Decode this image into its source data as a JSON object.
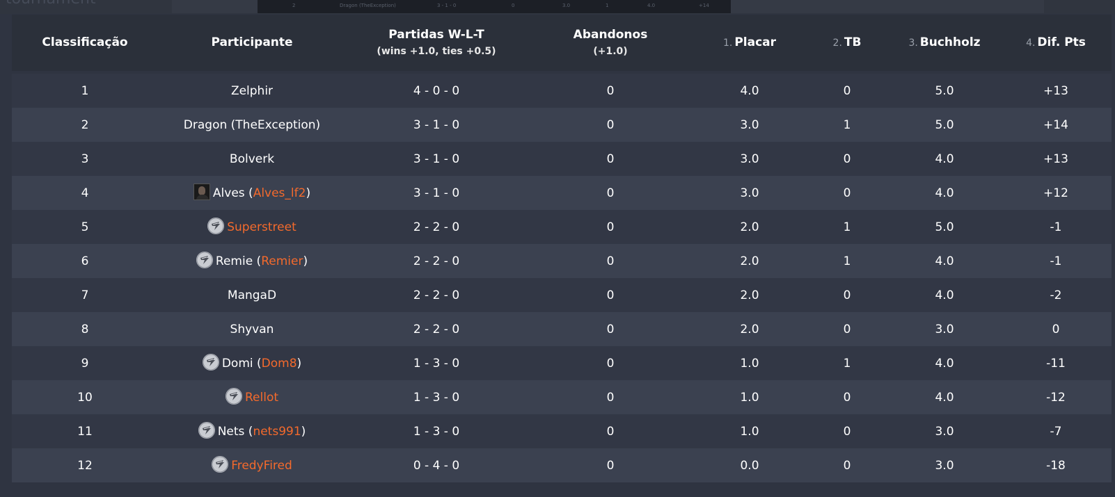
{
  "background_title": "-tournament",
  "background_row": {
    "rank": "2",
    "name": "Dragon (TheException)",
    "record": "3 - 1 - 0",
    "forfeits": "0",
    "score": "3.0",
    "tb": "1",
    "buchholz": "4.0",
    "diff": "+14"
  },
  "colors": {
    "accent": "#f46a2c",
    "header_bg": "#2b303a",
    "row_odd": "#3b4150",
    "row_even": "#323745"
  },
  "columns": {
    "rank": "Classificação",
    "participant": "Participante",
    "record": "Partidas W-L-T",
    "record_sub": "(wins +1.0, ties +0.5)",
    "forfeits": "Abandonos",
    "forfeits_sub": "(+1.0)",
    "score_prio": "1.",
    "score": "Placar",
    "tb_prio": "2.",
    "tb": "TB",
    "buchholz_prio": "3.",
    "buchholz": "Buchholz",
    "diff_prio": "4.",
    "diff": "Dif. Pts"
  },
  "rows": [
    {
      "rank": "1",
      "name": "Zelphir",
      "user": "",
      "avatar": "none",
      "record": "4 - 0 - 0",
      "forfeits": "0",
      "score": "4.0",
      "tb": "0",
      "buchholz": "5.0",
      "diff": "+13"
    },
    {
      "rank": "2",
      "name": "Dragon (TheException)",
      "user": "",
      "avatar": "none",
      "record": "3 - 1 - 0",
      "forfeits": "0",
      "score": "3.0",
      "tb": "1",
      "buchholz": "5.0",
      "diff": "+14"
    },
    {
      "rank": "3",
      "name": "Bolverk",
      "user": "",
      "avatar": "none",
      "record": "3 - 1 - 0",
      "forfeits": "0",
      "score": "3.0",
      "tb": "0",
      "buchholz": "4.0",
      "diff": "+13"
    },
    {
      "rank": "4",
      "name": "Alves",
      "user": "Alves_lf2",
      "avatar": "photo-avatar-icon",
      "record": "3 - 1 - 0",
      "forfeits": "0",
      "score": "3.0",
      "tb": "0",
      "buchholz": "4.0",
      "diff": "+12"
    },
    {
      "rank": "5",
      "name": "",
      "user": "Superstreet",
      "avatar": "logo-avatar-icon",
      "record": "2 - 2 - 0",
      "forfeits": "0",
      "score": "2.0",
      "tb": "1",
      "buchholz": "5.0",
      "diff": "-1"
    },
    {
      "rank": "6",
      "name": "Remie",
      "user": "Remier",
      "avatar": "logo-avatar-icon",
      "record": "2 - 2 - 0",
      "forfeits": "0",
      "score": "2.0",
      "tb": "1",
      "buchholz": "4.0",
      "diff": "-1"
    },
    {
      "rank": "7",
      "name": "MangaD",
      "user": "",
      "avatar": "none",
      "record": "2 - 2 - 0",
      "forfeits": "0",
      "score": "2.0",
      "tb": "0",
      "buchholz": "4.0",
      "diff": "-2"
    },
    {
      "rank": "8",
      "name": "Shyvan",
      "user": "",
      "avatar": "none",
      "record": "2 - 2 - 0",
      "forfeits": "0",
      "score": "2.0",
      "tb": "0",
      "buchholz": "3.0",
      "diff": "0"
    },
    {
      "rank": "9",
      "name": "Domi",
      "user": "Dom8",
      "avatar": "logo-avatar-icon",
      "record": "1 - 3 - 0",
      "forfeits": "0",
      "score": "1.0",
      "tb": "1",
      "buchholz": "4.0",
      "diff": "-11"
    },
    {
      "rank": "10",
      "name": "",
      "user": "Rellot",
      "avatar": "logo-avatar-icon",
      "record": "1 - 3 - 0",
      "forfeits": "0",
      "score": "1.0",
      "tb": "0",
      "buchholz": "4.0",
      "diff": "-12"
    },
    {
      "rank": "11",
      "name": "Nets",
      "user": "nets991",
      "avatar": "logo-avatar-icon",
      "record": "1 - 3 - 0",
      "forfeits": "0",
      "score": "1.0",
      "tb": "0",
      "buchholz": "3.0",
      "diff": "-7"
    },
    {
      "rank": "12",
      "name": "",
      "user": "FredyFired",
      "avatar": "logo-avatar-icon",
      "record": "0 - 4 - 0",
      "forfeits": "0",
      "score": "0.0",
      "tb": "0",
      "buchholz": "3.0",
      "diff": "-18"
    }
  ]
}
